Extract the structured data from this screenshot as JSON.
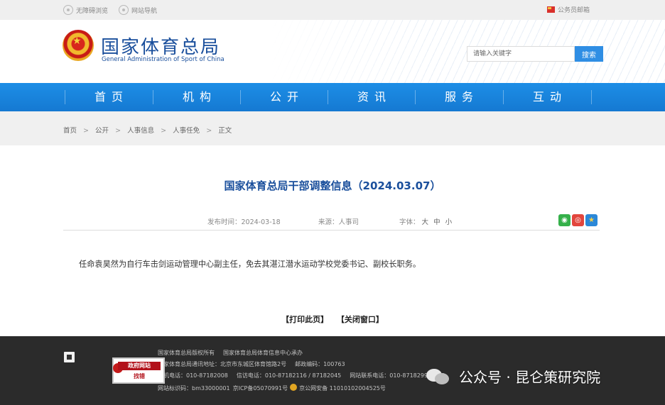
{
  "topbar": {
    "accessible": "无障碍浏览",
    "site_nav": "网站导航",
    "mailbox": "公务员邮箱"
  },
  "header": {
    "site_name_cn": "国家体育总局",
    "site_name_en": "General Administration of Sport of China",
    "search_placeholder": "请输入关键字",
    "search_button": "搜索"
  },
  "nav": {
    "items": [
      "首页",
      "机构",
      "公开",
      "资讯",
      "服务",
      "互动"
    ]
  },
  "breadcrumb": {
    "items": [
      "首页",
      "公开",
      "人事信息",
      "人事任免",
      "正文"
    ],
    "separator": ">"
  },
  "article": {
    "title": "国家体育总局干部调整信息（2024.03.07）",
    "publish_time": "发布时间：2024-03-18",
    "source": "来源：人事司",
    "font_label": "字体：",
    "font_sizes": [
      "大",
      "中",
      "小"
    ],
    "body": "任命袁昊然为自行车击剑运动管理中心副主任，免去其湛江潜水运动学校党委书记、副校长职务。"
  },
  "actions": {
    "print": "【打印此页】",
    "close": "【关闭窗口】"
  },
  "share_icons": [
    "wechat-icon",
    "weibo-icon",
    "qzone-icon"
  ],
  "footer": {
    "copyright": "国家体育总局版权所有",
    "maintainer": "国家体育总局体育信息中心承办",
    "address_line": "国家体育总局通讯地址：北京市东城区体育馆路2号",
    "postcode": "邮政编码：100763",
    "phone": "总机电话：010-87182008",
    "letters_phone": "信访电话：010-87182116 / 87182045",
    "web_contact": "网站联系电话：010-87182998 / 87",
    "site_id": "网站标识码：bm33000001",
    "icp": "京ICP备05070991号",
    "police": "京公网安备 11010102004525号",
    "gov_badge_top": "政府网站",
    "gov_badge_bottom": "找错"
  },
  "watermark": "公众号 · 昆仑策研究院",
  "colors": {
    "nav_blue": "#1b87e0",
    "title_blue": "#1a4f9c",
    "footer_bg": "#2b2b2b",
    "search_btn": "#2f8ee4"
  }
}
